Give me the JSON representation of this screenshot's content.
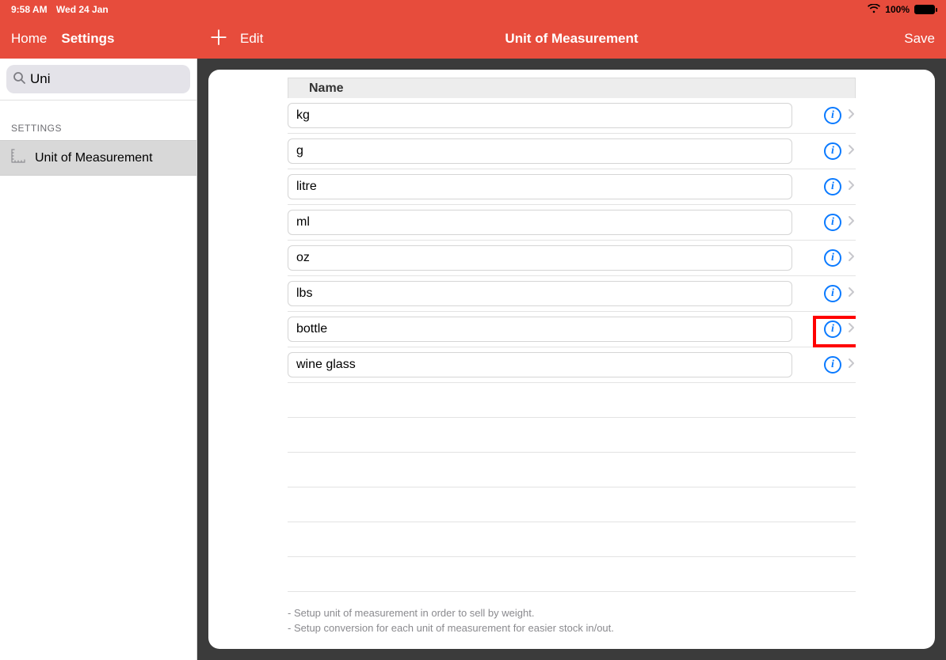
{
  "statusbar": {
    "time": "9:58 AM",
    "date": "Wed 24 Jan",
    "battery_pct": "100%"
  },
  "toolbar": {
    "home_label": "Home",
    "settings_label": "Settings",
    "edit_label": "Edit",
    "title": "Unit of Measurement",
    "save_label": "Save"
  },
  "sidebar": {
    "search_value": "Uni",
    "search_placeholder": "Search",
    "section_label": "SETTINGS",
    "items": [
      {
        "label": "Unit of Measurement",
        "selected": true
      }
    ]
  },
  "table": {
    "column_header": "Name",
    "rows": [
      {
        "name": "kg"
      },
      {
        "name": "g"
      },
      {
        "name": "litre"
      },
      {
        "name": "ml"
      },
      {
        "name": "oz"
      },
      {
        "name": "lbs"
      },
      {
        "name": "bottle",
        "highlighted": true
      },
      {
        "name": "wine glass"
      }
    ],
    "empty_rows": 6
  },
  "footer": {
    "line1": "- Setup unit of measurement in order to sell by weight.",
    "line2": "- Setup conversion for each unit of measurement for easier stock in/out."
  },
  "colors": {
    "brand": "#e74c3c",
    "info_blue": "#0a7aff",
    "highlight_red": "#ff0000"
  }
}
